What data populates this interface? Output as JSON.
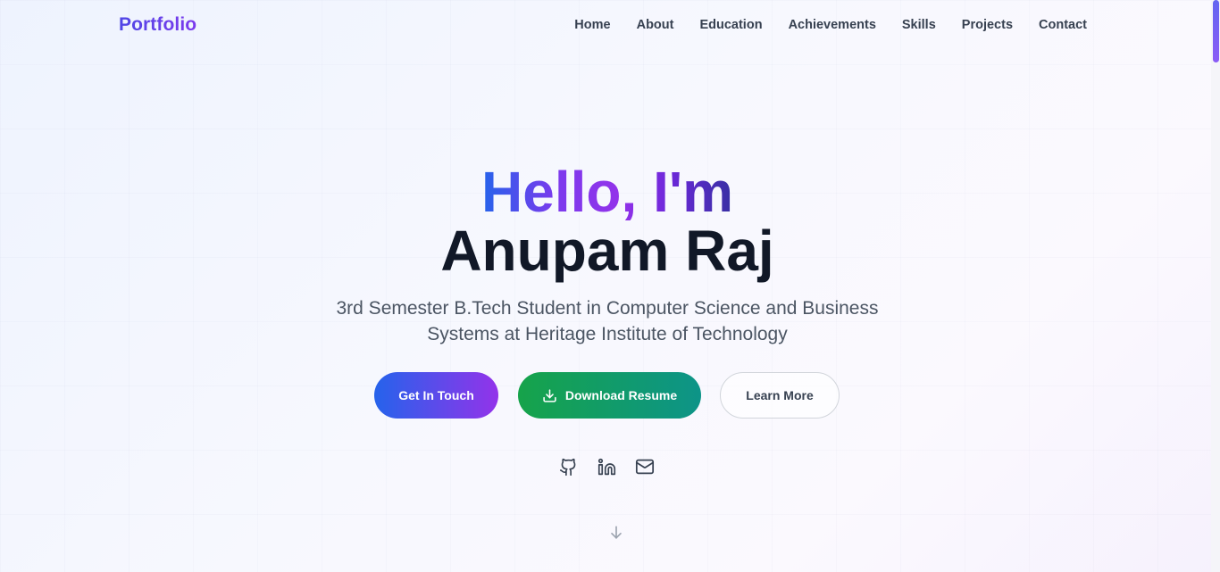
{
  "navbar": {
    "brand": "Portfolio",
    "links": [
      {
        "label": "Home"
      },
      {
        "label": "About"
      },
      {
        "label": "Education"
      },
      {
        "label": "Achievements"
      },
      {
        "label": "Skills"
      },
      {
        "label": "Projects"
      },
      {
        "label": "Contact"
      }
    ]
  },
  "hero": {
    "greeting": "Hello, I'm",
    "name": "Anupam Raj",
    "tagline": "3rd Semester B.Tech Student in Computer Science and Business Systems at Heritage Institute of Technology",
    "buttons": {
      "get_in_touch": "Get In Touch",
      "download_resume": "Download Resume",
      "learn_more": "Learn More"
    },
    "social_icons": [
      "github-icon",
      "linkedin-icon",
      "mail-icon"
    ],
    "scroll_icon": "arrow-down-icon"
  },
  "colors": {
    "brand_gradient": [
      "#4f46e5",
      "#7c3aed"
    ],
    "primary_gradient": [
      "#2563eb",
      "#9333ea"
    ],
    "success_gradient": [
      "#16a34a",
      "#0d9488"
    ],
    "text_dark": "#111827",
    "text_muted": "#4b5563"
  }
}
